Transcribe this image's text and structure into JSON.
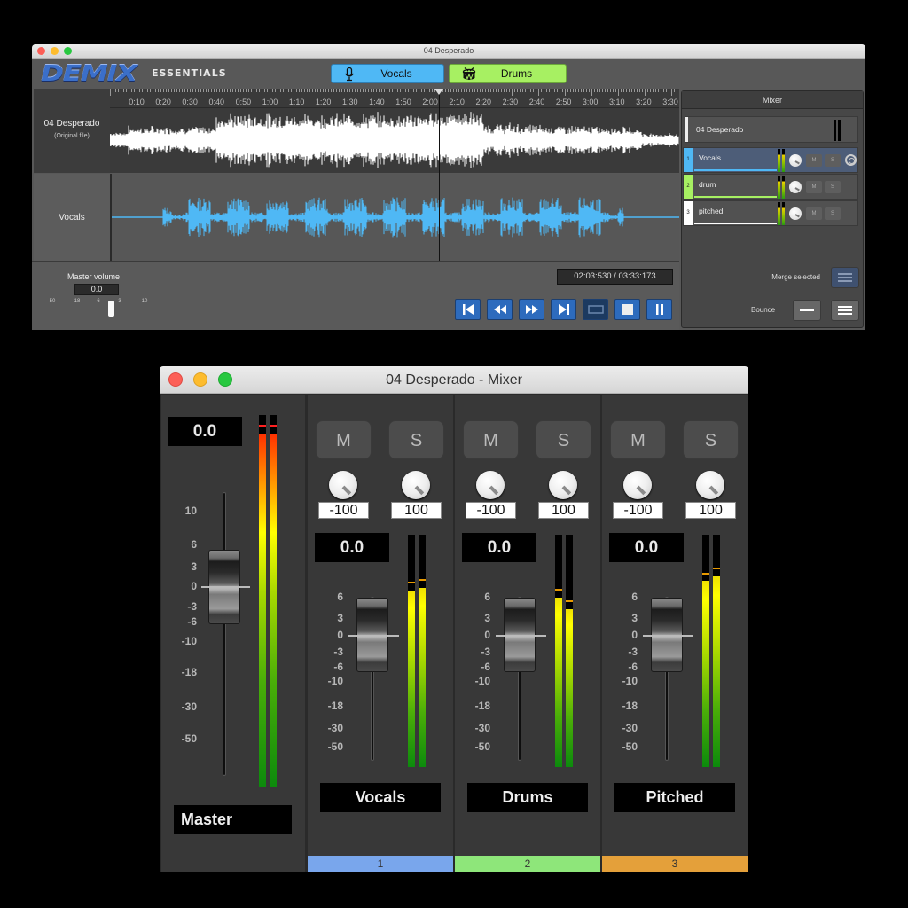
{
  "window_main": {
    "title": "04 Desperado",
    "logo": {
      "primary": "DEMIX",
      "secondary": "ESSENTIALS"
    },
    "stem_buttons": [
      {
        "label": "Vocals",
        "icon": "microphone-icon",
        "color": "#4fb8f5"
      },
      {
        "label": "Drums",
        "icon": "drum-icon",
        "color": "#a7f062"
      }
    ],
    "timeline": {
      "ticks": [
        "0:10",
        "0:20",
        "0:30",
        "0:40",
        "0:50",
        "1:00",
        "1:10",
        "1:20",
        "1:30",
        "1:40",
        "1:50",
        "2:00",
        "2:10",
        "2:20",
        "2:30",
        "2:40",
        "2:50",
        "3:00",
        "3:10",
        "3:20",
        "3:30"
      ]
    },
    "tracks": [
      {
        "title": "04 Desperado",
        "subtitle": "(Original file)",
        "waveform_color": "#ffffff"
      },
      {
        "title": "Vocals",
        "subtitle": "",
        "waveform_color": "#4fb8f5"
      }
    ],
    "master_volume": {
      "label": "Master volume",
      "value": "0.0",
      "scale": [
        "-50",
        "-18",
        "-6",
        "3",
        "10"
      ]
    },
    "time_display": "02:03:530 / 03:33:173",
    "transport": [
      {
        "name": "skip-to-start",
        "icon": "skip-start-icon"
      },
      {
        "name": "rewind",
        "icon": "rewind-icon"
      },
      {
        "name": "fast-forward",
        "icon": "fast-forward-icon"
      },
      {
        "name": "skip-to-end",
        "icon": "skip-end-icon"
      },
      {
        "name": "loop",
        "icon": "loop-icon"
      },
      {
        "name": "stop",
        "icon": "stop-icon"
      },
      {
        "name": "pause",
        "icon": "pause-icon"
      }
    ],
    "mixer_panel": {
      "header": "Mixer",
      "original": "04 Desperado",
      "rows": [
        {
          "num": "1",
          "name": "Vocals",
          "color": "#4fb8f5",
          "mute": "M",
          "solo": "S",
          "selected": true
        },
        {
          "num": "2",
          "name": "drum",
          "color": "#a7f062",
          "mute": "M",
          "solo": "S",
          "selected": false
        },
        {
          "num": "3",
          "name": "pitched",
          "color": "#ffffff",
          "mute": "M",
          "solo": "S",
          "selected": false
        }
      ],
      "merge_label": "Merge selected",
      "bounce_label": "Bounce"
    }
  },
  "window_mixer": {
    "title": "04 Desperado - Mixer",
    "master": {
      "value": "0.0",
      "name": "Master",
      "scale": [
        "10",
        "6",
        "3",
        "0",
        "-3",
        "-6",
        "-10",
        "-18",
        "-30",
        "-50"
      ],
      "fader_db": 0.0,
      "meter_levels": [
        0.95,
        0.95
      ]
    },
    "channels": [
      {
        "name": "Vocals",
        "number": "1",
        "color": "#79a6ec",
        "mute": "M",
        "solo": "S",
        "pan_left": "-100",
        "pan_right": "100",
        "value": "0.0",
        "fader_db": 0.0,
        "meter_levels": [
          0.76,
          0.77
        ]
      },
      {
        "name": "Drums",
        "number": "2",
        "color": "#8ee67a",
        "mute": "M",
        "solo": "S",
        "pan_left": "-100",
        "pan_right": "100",
        "value": "0.0",
        "fader_db": 0.0,
        "meter_levels": [
          0.73,
          0.68
        ]
      },
      {
        "name": "Pitched",
        "number": "3",
        "color": "#e4a03a",
        "mute": "M",
        "solo": "S",
        "pan_left": "-100",
        "pan_right": "100",
        "value": "0.0",
        "fader_db": 0.0,
        "meter_levels": [
          0.8,
          0.82
        ]
      }
    ],
    "channel_scale": [
      "6",
      "3",
      "0",
      "-3",
      "-6",
      "-10",
      "-18",
      "-30",
      "-50"
    ]
  }
}
